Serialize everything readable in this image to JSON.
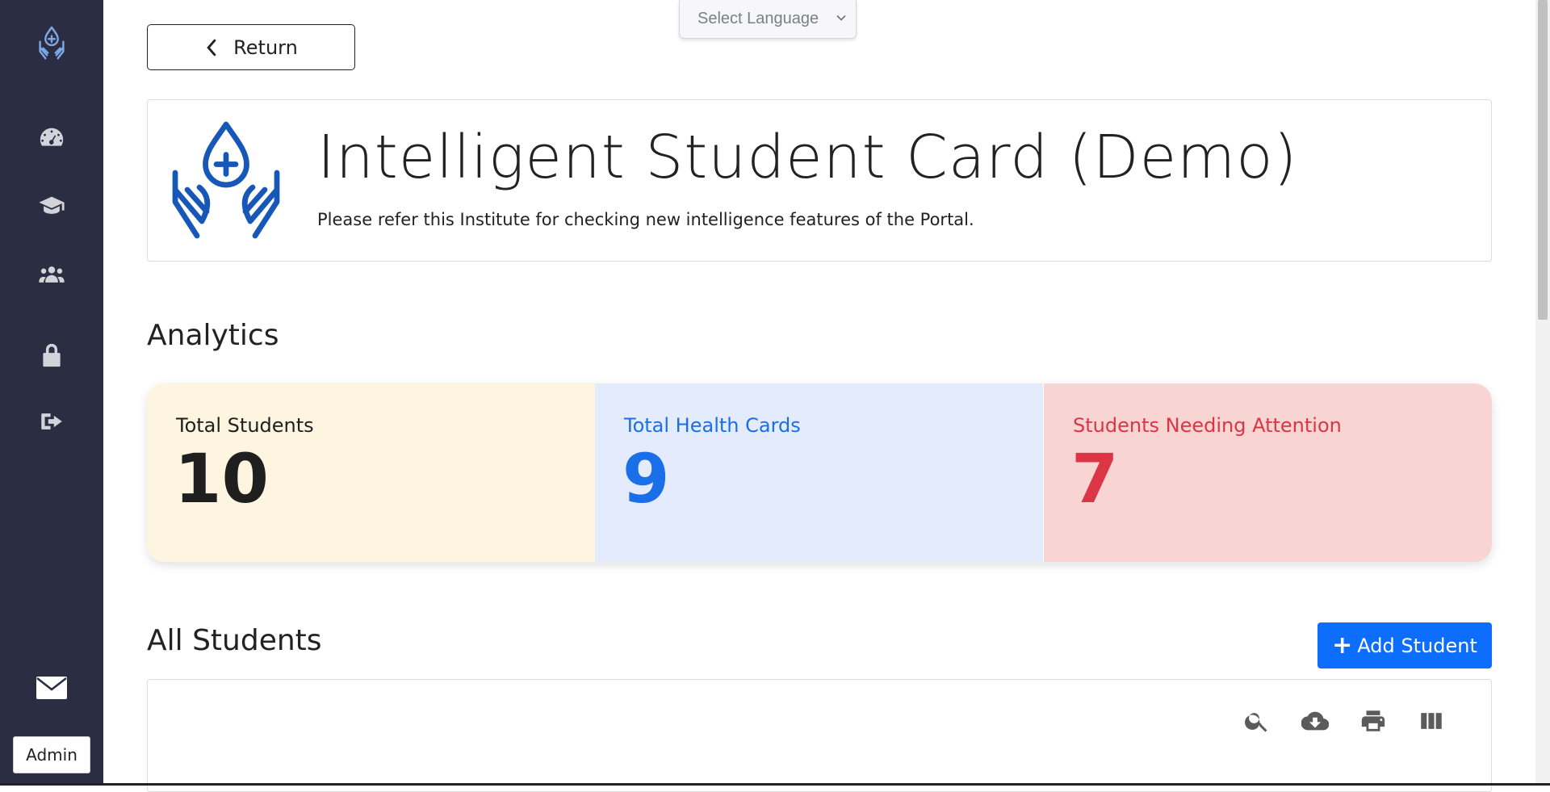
{
  "language_select": {
    "value": "Select Language"
  },
  "return_label": "Return",
  "hero": {
    "title": "Intelligent Student Card (Demo)",
    "subtitle": "Please refer this Institute for checking new intelligence features of the Portal."
  },
  "analytics_heading": "Analytics",
  "stats": [
    {
      "label": "Total Students",
      "value": "10"
    },
    {
      "label": "Total Health Cards",
      "value": "9"
    },
    {
      "label": "Students Needing Attention",
      "value": "7"
    }
  ],
  "all_students_heading": "All Students",
  "add_student_label": "Add Student",
  "sidebar": {
    "admin_label": "Admin",
    "items": [
      "dashboard",
      "students",
      "groups",
      "security",
      "logout"
    ]
  },
  "colors": {
    "sidebar_bg": "#2b2d42",
    "primary": "#0d6efd",
    "attention": "#dc3545"
  }
}
